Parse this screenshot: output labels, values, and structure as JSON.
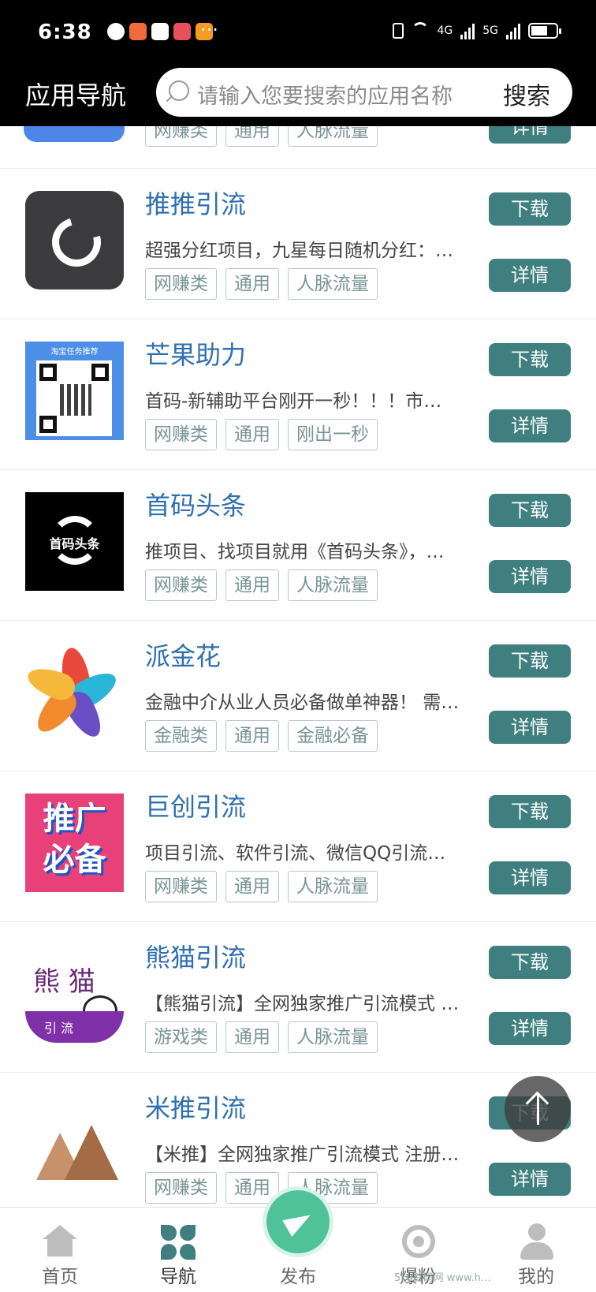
{
  "status": {
    "time": "6:38",
    "more": "···",
    "net1": "4G",
    "net2": "5G"
  },
  "header": {
    "title": "应用导航",
    "search_placeholder": "请输入您要搜索的应用名称",
    "search_button": "搜索"
  },
  "top_partial": {
    "tags": [
      "网赚类",
      "通用",
      "人脉流量"
    ],
    "detail": "详情"
  },
  "apps": [
    {
      "name": "推推引流",
      "desc": "超强分红项目，九星每日随机分红：…",
      "tags": [
        "网赚类",
        "通用",
        "人脉流量"
      ],
      "download": "下载",
      "detail": "详情",
      "icon": "spinner-icon"
    },
    {
      "name": "芒果助力",
      "desc": "首码-新辅助平台刚开一秒！！！市…",
      "tags": [
        "网赚类",
        "通用",
        "刚出一秒"
      ],
      "download": "下载",
      "detail": "详情",
      "icon": "qrcode-icon",
      "icon_caption": "淘宝任务推荐"
    },
    {
      "name": "首码头条",
      "desc": "推项目、找项目就用《首码头条》，…",
      "tags": [
        "网赚类",
        "通用",
        "人脉流量"
      ],
      "download": "下载",
      "detail": "详情",
      "icon": "shouma-logo-icon",
      "icon_caption": "首码头条"
    },
    {
      "name": "派金花",
      "desc": "金融中介从业人员必备做单神器！ 需…",
      "tags": [
        "金融类",
        "通用",
        "金融必备"
      ],
      "download": "下载",
      "detail": "详情",
      "icon": "flower-logo-icon"
    },
    {
      "name": "巨创引流",
      "desc": "项目引流、软件引流、微信QQ引流…",
      "tags": [
        "网赚类",
        "通用",
        "人脉流量"
      ],
      "download": "下载",
      "detail": "详情",
      "icon": "promo-logo-icon",
      "icon_caption": "推广必备"
    },
    {
      "name": "熊猫引流",
      "desc": "【熊猫引流】全网独家推广引流模式 …",
      "tags": [
        "游戏类",
        "通用",
        "人脉流量"
      ],
      "download": "下载",
      "detail": "详情",
      "icon": "panda-logo-icon",
      "icon_caption": "熊 猫",
      "icon_band": "引 流"
    },
    {
      "name": "米推引流",
      "desc": "【米推】全网独家推广引流模式 注册…",
      "tags": [
        "网赚类",
        "通用",
        "人脉流量"
      ],
      "download": "下载",
      "detail": "详情",
      "icon": "mountain-logo-icon"
    }
  ],
  "nav": [
    {
      "label": "首页",
      "icon": "home-icon"
    },
    {
      "label": "导航",
      "icon": "grid-icon"
    },
    {
      "label": "发布",
      "icon": "paper-plane-icon"
    },
    {
      "label": "爆粉",
      "icon": "target-icon"
    },
    {
      "label": "我的",
      "icon": "user-icon"
    }
  ],
  "watermark": "5ku首码网 www.h…"
}
